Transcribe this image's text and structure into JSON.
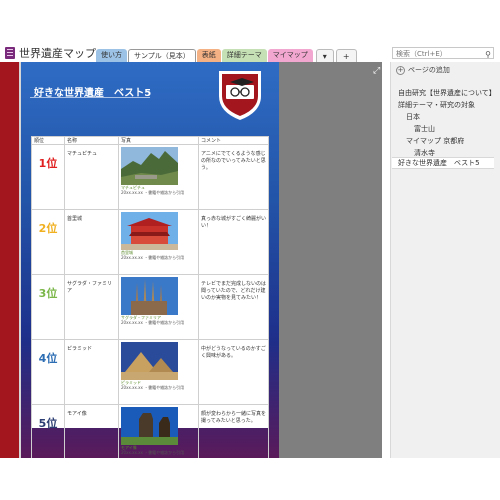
{
  "notebook": {
    "title": "世界遺産マップ"
  },
  "tabs": [
    {
      "label": "使い方",
      "color": "#9cc3e6"
    },
    {
      "label": "サンプル（見本）",
      "color": "#ffffff"
    },
    {
      "label": "表紙",
      "color": "#f4b183"
    },
    {
      "label": "詳細テーマ",
      "color": "#c5e0b4"
    },
    {
      "label": "マイマップ",
      "color": "#f2a7d0"
    }
  ],
  "tab_controls": {
    "more": "▾",
    "add": "+"
  },
  "search": {
    "placeholder": "検索（Ctrl+E）"
  },
  "page": {
    "title": "好きな世界遺産　ベスト5",
    "table": {
      "headers": [
        "順位",
        "名称",
        "写真",
        "コメント"
      ],
      "rows": [
        {
          "rank": "1位",
          "rank_color": "#e02020",
          "name": "マチュピチュ",
          "caption": "マチュピチュ",
          "source": "20xx.xx.xx ・書籍や雑誌から引用",
          "comment": "アニメにでてくるような感じの所なのでいってみたいと思う。"
        },
        {
          "rank": "2位",
          "rank_color": "#f0b020",
          "name": "首里城",
          "caption": "首里城",
          "source": "20xx.xx.xx ・書籍や雑誌から引用",
          "comment": "真っ赤な城がすごく綺麗がいい！"
        },
        {
          "rank": "3位",
          "rank_color": "#7ab648",
          "name": "サグラダ・ファミリア",
          "caption": "サグラダ・ファミリア",
          "source": "20xx.xx.xx ・書籍や雑誌から引用",
          "comment": "テレビでまだ完成しないのは聞っていたので、どれだけ建いのか実物を見てみたい！"
        },
        {
          "rank": "4位",
          "rank_color": "#2c6db3",
          "name": "ピラミッド",
          "caption": "ピラミッド",
          "source": "20xx.xx.xx ・書籍や雑誌から引用",
          "comment": "中がどうなっているのかすごく興味がある。"
        },
        {
          "rank": "5位",
          "rank_color": "#2c3e73",
          "name": "モアイ像",
          "caption": "モアイ像",
          "source": "20xx.xx.xx ・書籍や雑誌から引用",
          "comment": "顔が変わらから一緒に写真を撮ってみたいと思った。"
        }
      ]
    }
  },
  "sidebar": {
    "add_page": "ページの追加",
    "items": [
      {
        "label": "自由研究【世界遺産について】"
      },
      {
        "label": "詳細テーマ・研究の対象"
      },
      {
        "label": "日本"
      },
      {
        "label": "富士山"
      },
      {
        "label": "マイマップ 京都府"
      },
      {
        "label": "清水寺"
      },
      {
        "label": "好きな世界遺産　ベスト5"
      }
    ]
  }
}
